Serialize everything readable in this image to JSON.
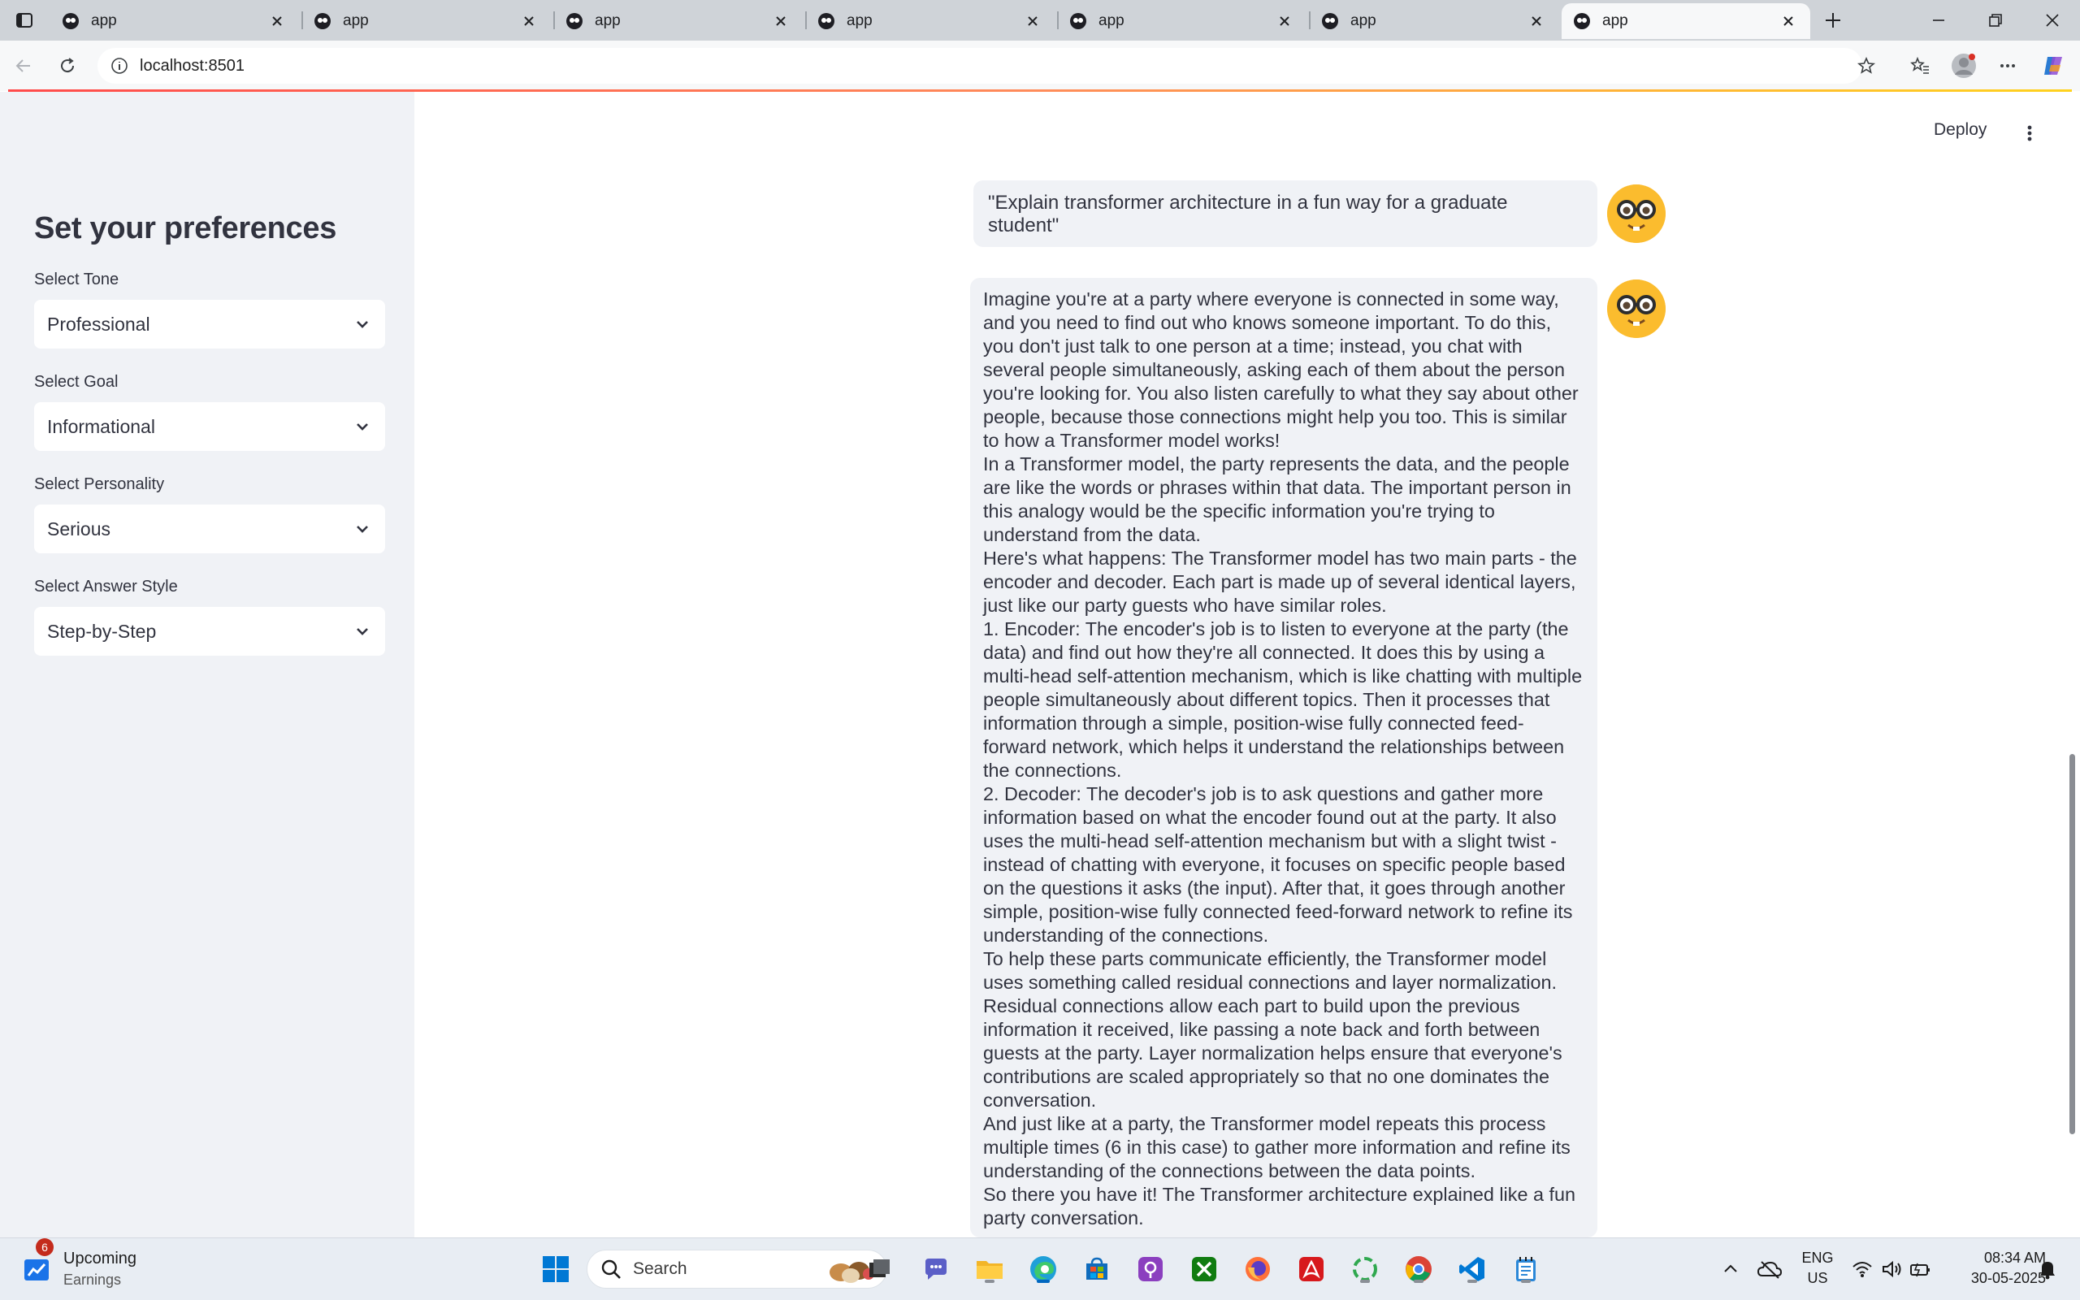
{
  "browser": {
    "tabs": [
      {
        "label": "app"
      },
      {
        "label": "app"
      },
      {
        "label": "app"
      },
      {
        "label": "app"
      },
      {
        "label": "app"
      },
      {
        "label": "app"
      },
      {
        "label": "app"
      }
    ],
    "url": "localhost:8501"
  },
  "app": {
    "deploy_label": "Deploy",
    "sidebar": {
      "title": "Set your preferences",
      "selects": [
        {
          "label": "Select Tone",
          "value": "Professional"
        },
        {
          "label": "Select Goal",
          "value": "Informational"
        },
        {
          "label": "Select Personality",
          "value": "Serious"
        },
        {
          "label": "Select Answer Style",
          "value": "Step-by-Step"
        }
      ]
    },
    "chat": {
      "user_message": "\"Explain transformer architecture in a fun way for a graduate student\"",
      "assistant_paragraphs": [
        "Imagine you're at a party where everyone is connected in some way, and you need to find out who knows someone important. To do this, you don't just talk to one person at a time; instead, you chat with several people simultaneously, asking each of them about the person you're looking for. You also listen carefully to what they say about other people, because those connections might help you too. This is similar to how a Transformer model works!",
        "In a Transformer model, the party represents the data, and the people are like the words or phrases within that data. The important person in this analogy would be the specific information you're trying to understand from the data.",
        "Here's what happens: The Transformer model has two main parts - the encoder and decoder. Each part is made up of several identical layers, just like our party guests who have similar roles.",
        "1. Encoder: The encoder's job is to listen to everyone at the party (the data) and find out how they're all connected. It does this by using a multi-head self-attention mechanism, which is like chatting with multiple people simultaneously about different topics. Then it processes that information through a simple, position-wise fully connected feed-forward network, which helps it understand the relationships between the connections.",
        "2. Decoder: The decoder's job is to ask questions and gather more information based on what the encoder found out at the party. It also uses the multi-head self-attention mechanism but with a slight twist - instead of chatting with everyone, it focuses on specific people based on the questions it asks (the input). After that, it goes through another simple, position-wise fully connected feed-forward network to refine its understanding of the connections.",
        "To help these parts communicate efficiently, the Transformer model uses something called residual connections and layer normalization. Residual connections allow each part to build upon the previous information it received, like passing a note back and forth between guests at the party. Layer normalization helps ensure that everyone's contributions are scaled appropriately so that no one dominates the conversation.",
        "And just like at a party, the Transformer model repeats this process multiple times (6 in this case) to gather more information and refine its understanding of the connections between the data points.",
        "So there you have it! The Transformer architecture explained like a fun party conversation."
      ]
    }
  },
  "taskbar": {
    "weather_badge": "6",
    "weather_title": "Upcoming",
    "weather_subtitle": "Earnings",
    "search_label": "Search",
    "language_line1": "ENG",
    "language_line2": "US",
    "time": "08:34 AM",
    "date": "30-05-2025"
  },
  "colors": {
    "accent": "#ff4b4b",
    "sidebar_bg": "#f0f2f6",
    "avatar": "#fbbc2e",
    "tabbar_bg": "#cfd3d8"
  }
}
